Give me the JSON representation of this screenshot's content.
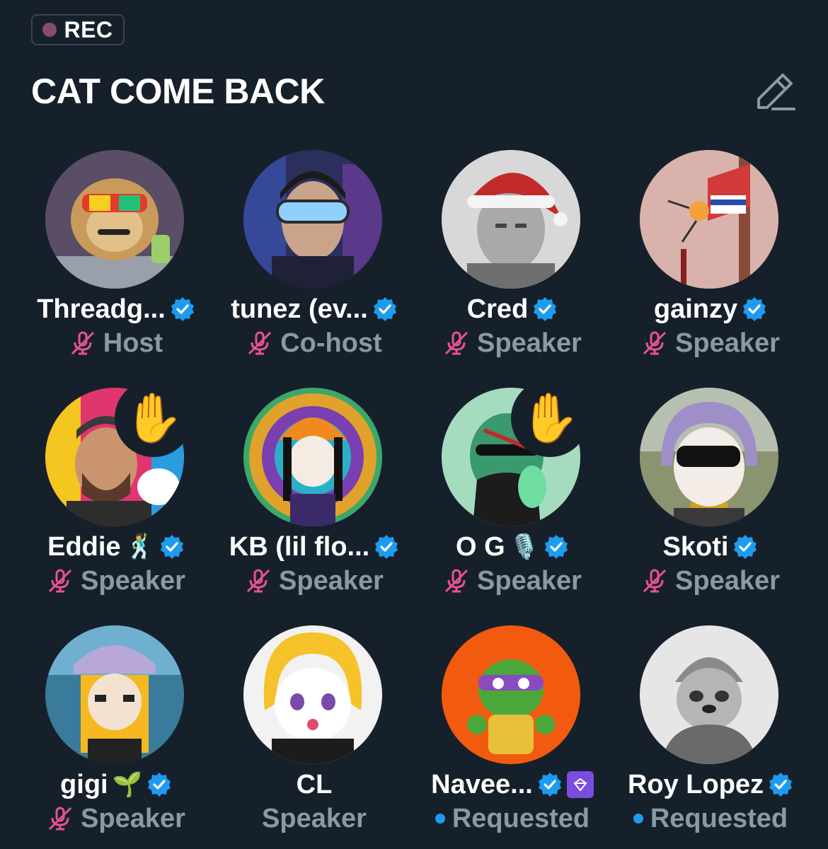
{
  "header": {
    "rec_label": "REC",
    "title": "CAT COME BACK"
  },
  "colors": {
    "background": "#16202b",
    "muted_text": "#8b98a6",
    "verified_blue": "#1d9bf0",
    "mic_muted_pink": "#e8528f",
    "rec_dot": "#8a4a6e"
  },
  "participants": [
    {
      "name": "Threadg...",
      "role": "Host",
      "verified": true,
      "muted": true,
      "emoji": "",
      "hand_raised": false,
      "requested": false
    },
    {
      "name": "tunez (ev...",
      "role": "Co-host",
      "verified": true,
      "muted": true,
      "emoji": "",
      "hand_raised": false,
      "requested": false
    },
    {
      "name": "Cred",
      "role": "Speaker",
      "verified": true,
      "muted": true,
      "emoji": "",
      "hand_raised": false,
      "requested": false
    },
    {
      "name": "gainzy",
      "role": "Speaker",
      "verified": true,
      "muted": true,
      "emoji": "",
      "hand_raised": false,
      "requested": false
    },
    {
      "name": "Eddie",
      "role": "Speaker",
      "verified": true,
      "muted": true,
      "emoji": "🕺",
      "hand_raised": true,
      "requested": false
    },
    {
      "name": "KB (lil flo...",
      "role": "Speaker",
      "verified": true,
      "muted": true,
      "emoji": "",
      "hand_raised": false,
      "requested": false
    },
    {
      "name": "O G",
      "role": "Speaker",
      "verified": true,
      "muted": true,
      "emoji": "🎙️",
      "hand_raised": true,
      "requested": false
    },
    {
      "name": "Skoti",
      "role": "Speaker",
      "verified": true,
      "muted": true,
      "emoji": "",
      "hand_raised": false,
      "requested": false
    },
    {
      "name": "gigi",
      "role": "Speaker",
      "verified": true,
      "muted": true,
      "emoji": "🌱",
      "hand_raised": false,
      "requested": false
    },
    {
      "name": "CL",
      "role": "Speaker",
      "verified": false,
      "muted": false,
      "emoji": "",
      "hand_raised": false,
      "requested": false
    },
    {
      "name": "Navee...",
      "role": "Requested",
      "verified": true,
      "muted": false,
      "emoji": "",
      "hand_raised": false,
      "requested": true,
      "extra_badge": "app-badge-icon"
    },
    {
      "name": "Roy Lopez",
      "role": "Requested",
      "verified": true,
      "muted": false,
      "emoji": "",
      "hand_raised": false,
      "requested": true
    }
  ]
}
